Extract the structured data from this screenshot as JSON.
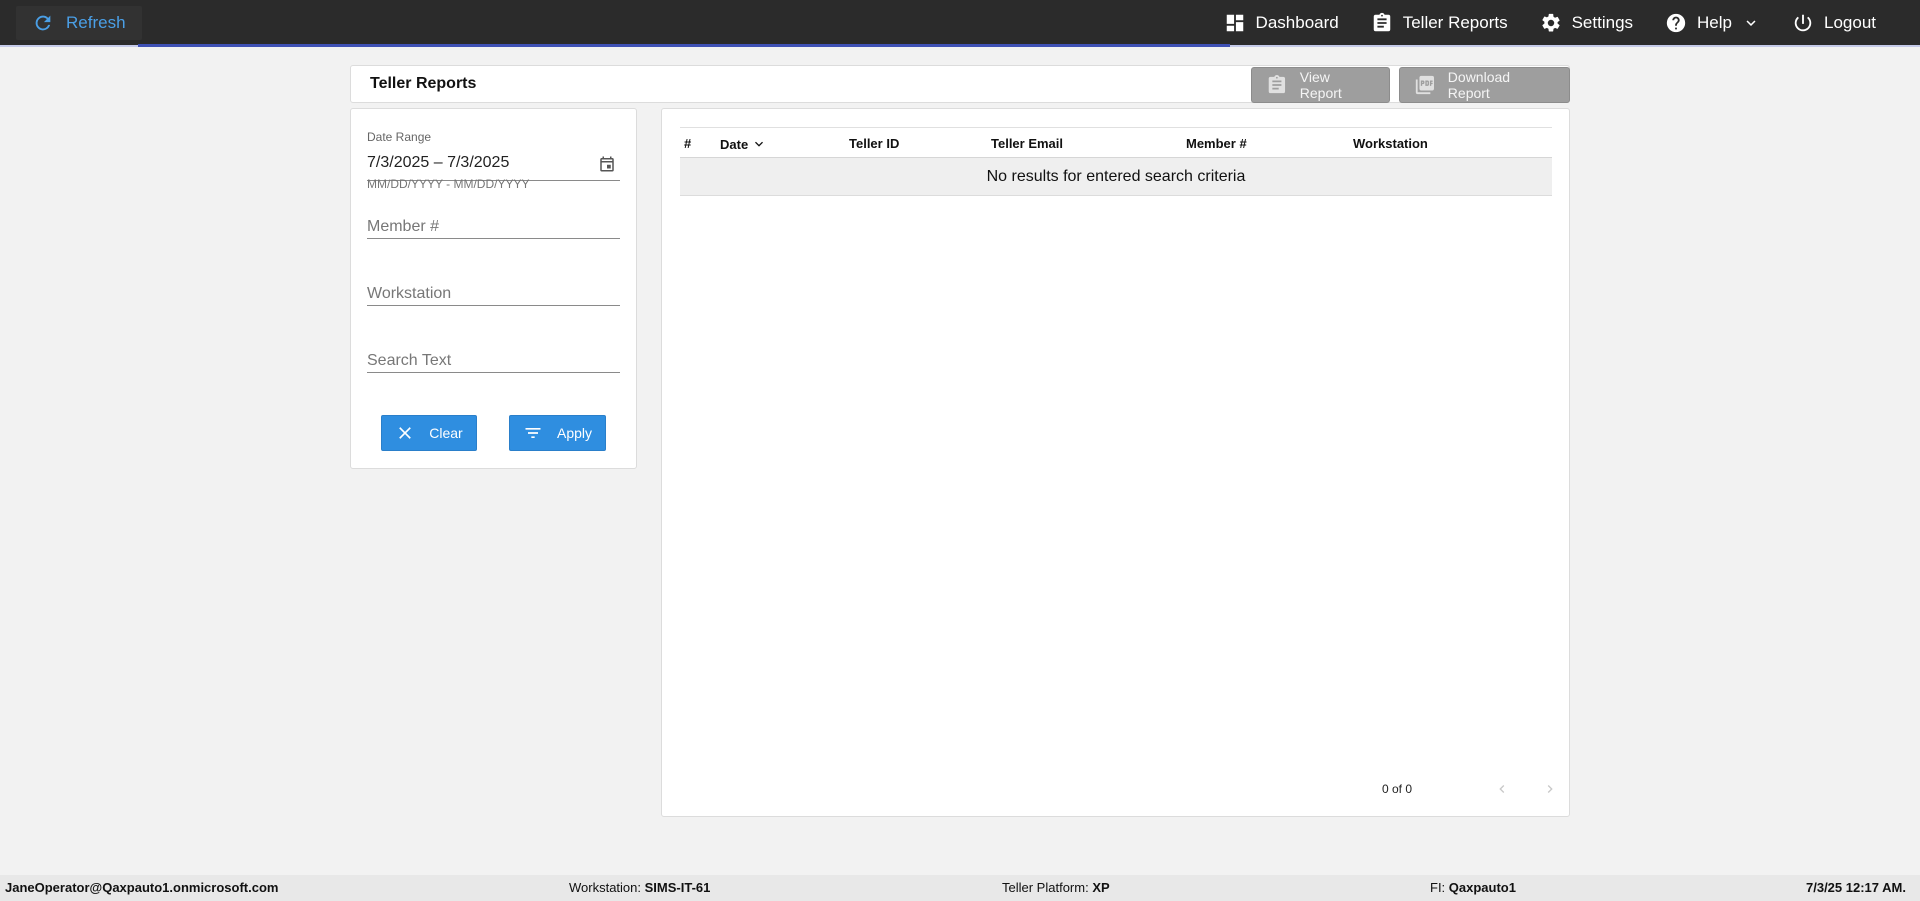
{
  "topbar": {
    "refresh_label": "Refresh",
    "nav": [
      {
        "label": "Dashboard",
        "icon": "dashboard-icon"
      },
      {
        "label": "Teller Reports",
        "icon": "clipboard-icon"
      },
      {
        "label": "Settings",
        "icon": "gear-icon"
      },
      {
        "label": "Help",
        "icon": "help-icon"
      },
      {
        "label": "Logout",
        "icon": "power-icon"
      }
    ]
  },
  "header": {
    "title": "Teller Reports",
    "view_report_label": "View Report",
    "download_report_label": "Download Report"
  },
  "filters": {
    "date_range_label": "Date Range",
    "date_range_value": "7/3/2025 – 7/3/2025",
    "date_hint": "MM/DD/YYYY - MM/DD/YYYY",
    "member_placeholder": "Member #",
    "workstation_placeholder": "Workstation",
    "search_placeholder": "Search Text",
    "clear_label": "Clear",
    "apply_label": "Apply"
  },
  "table": {
    "columns": [
      "#",
      "Date",
      "Teller ID",
      "Teller Email",
      "Member #",
      "Workstation"
    ],
    "empty_message": "No results for entered search criteria",
    "paginator_range": "0 of 0"
  },
  "status": {
    "user": "JaneOperator@Qaxpauto1.onmicrosoft.com",
    "workstation_label": "Workstation:",
    "workstation_value": "SIMS-IT-61",
    "platform_label": "Teller Platform:",
    "platform_value": "XP",
    "fi_label": "FI:",
    "fi_value": "Qaxpauto1",
    "datetime": "7/3/25 12:17 AM."
  },
  "colors": {
    "topbar": "#2b2b2b",
    "accent": "#2f8ee0",
    "progress": "#3f51b5",
    "disabled_button": "#9e9e9e"
  }
}
